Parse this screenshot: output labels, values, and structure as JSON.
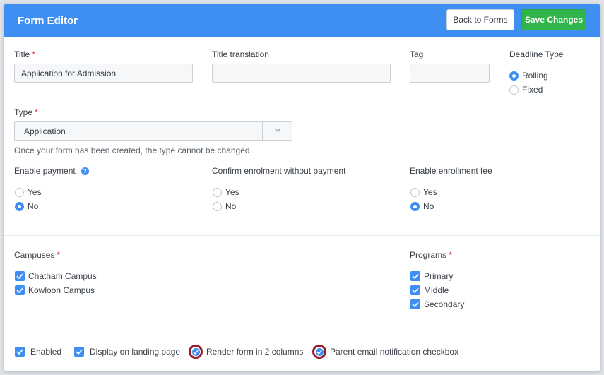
{
  "header": {
    "title": "Form Editor",
    "back_label": "Back to Forms",
    "save_label": "Save Changes"
  },
  "fields": {
    "title": {
      "label": "Title",
      "required_mark": "*",
      "value": "Application for Admission"
    },
    "title_translation": {
      "label": "Title translation",
      "value": ""
    },
    "tag": {
      "label": "Tag",
      "value": ""
    },
    "deadline_type": {
      "label": "Deadline Type",
      "options": [
        "Rolling",
        "Fixed"
      ],
      "selected": "Rolling"
    },
    "type": {
      "label": "Type",
      "required_mark": "*",
      "value": "Application",
      "hint": "Once your form has been created, the type cannot be changed."
    }
  },
  "payment": {
    "enable_payment": {
      "label": "Enable payment",
      "help_icon": "?",
      "options": [
        "Yes",
        "No"
      ],
      "selected": "No"
    },
    "confirm_enrolment": {
      "label": "Confirm enrolment without payment",
      "options": [
        "Yes",
        "No"
      ],
      "selected": ""
    },
    "enrollment_fee": {
      "label": "Enable enrollment fee",
      "options": [
        "Yes",
        "No"
      ],
      "selected": "No"
    }
  },
  "campuses": {
    "label": "Campuses",
    "required_mark": "*",
    "items": [
      "Chatham Campus",
      "Kowloon Campus"
    ],
    "checked": [
      true,
      true
    ]
  },
  "programs": {
    "label": "Programs",
    "required_mark": "*",
    "items": [
      "Primary",
      "Middle",
      "Secondary"
    ],
    "checked": [
      true,
      true,
      true
    ]
  },
  "footer_options": {
    "items": [
      "Enabled",
      "Display on landing page",
      "Render form in 2 columns",
      "Parent email notification checkbox"
    ],
    "checked": [
      true,
      true,
      true,
      true
    ],
    "highlighted": [
      false,
      false,
      true,
      true
    ]
  },
  "colors": {
    "accent": "#3f8ef2",
    "save": "#2fb54a",
    "required": "#e03b3b",
    "highlight_ring": "#9b1c28"
  }
}
